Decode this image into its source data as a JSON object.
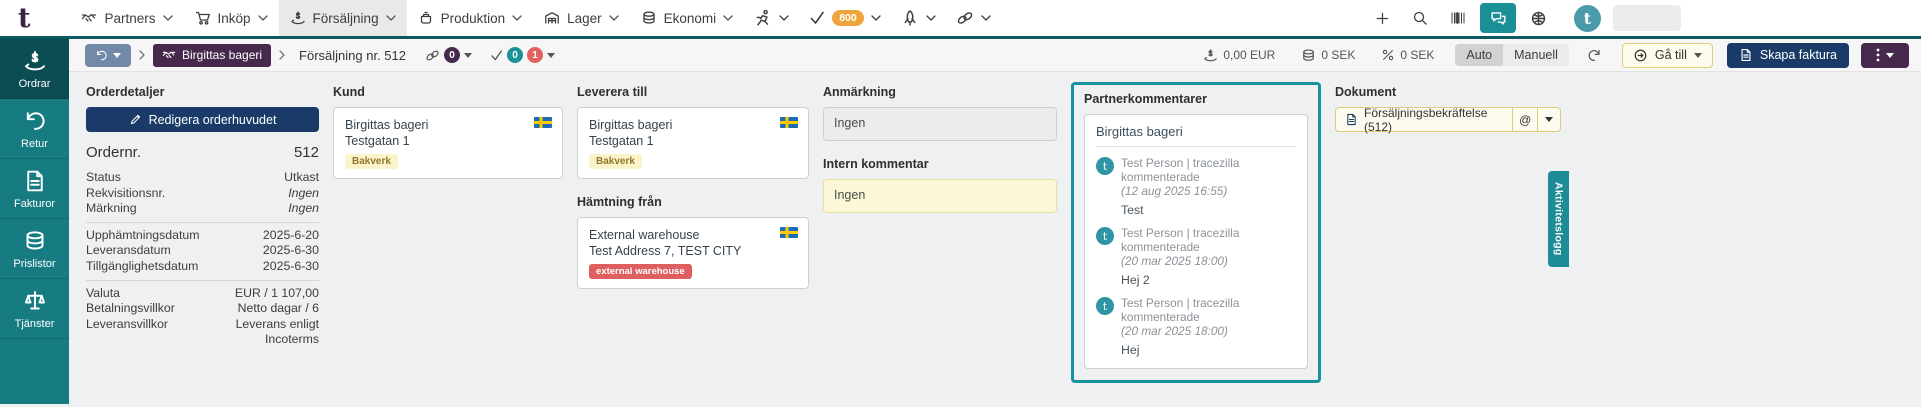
{
  "brand": {
    "letter": "t"
  },
  "topbar": {
    "nav": [
      {
        "label": "Partners"
      },
      {
        "label": "Inköp"
      },
      {
        "label": "Försäljning"
      },
      {
        "label": "Produktion"
      },
      {
        "label": "Lager"
      },
      {
        "label": "Ekonomi"
      }
    ],
    "tasks_badge": "800"
  },
  "toolbar": {
    "partner_chip": "Birgittas bageri",
    "order_label": "Försäljning nr. 512",
    "link_badge": "0",
    "check_badge_ok": "0",
    "check_badge_error": "1",
    "amount_eur": "0,00 EUR",
    "amount_sek": "0 SEK",
    "amount_margin": "0 SEK",
    "toggle_auto": "Auto",
    "toggle_manual": "Manuell",
    "go_to": "Gå till",
    "create_invoice": "Skapa faktura"
  },
  "sidebar": [
    {
      "label": "Ordrar"
    },
    {
      "label": "Retur"
    },
    {
      "label": "Fakturor"
    },
    {
      "label": "Prislistor"
    },
    {
      "label": "Tjänster"
    }
  ],
  "order_details": {
    "title": "Orderdetaljer",
    "edit_button": "Redigera orderhuvudet",
    "order_no_label": "Ordernr.",
    "order_no": "512",
    "rows": [
      {
        "label": "Status",
        "value": "Utkast"
      },
      {
        "label": "Rekvisitionsnr.",
        "value": "Ingen"
      },
      {
        "label": "Märkning",
        "value": "Ingen"
      },
      {
        "label": "Upphämtningsdatum",
        "value": "2025-6-20"
      },
      {
        "label": "Leveransdatum",
        "value": "2025-6-30"
      },
      {
        "label": "Tillgänglighetsdatum",
        "value": "2025-6-30"
      },
      {
        "label": "Valuta",
        "value": "EUR / 1 107,00"
      },
      {
        "label": "Betalningsvillkor",
        "value": "Netto dagar / 6"
      },
      {
        "label": "Leveransvillkor",
        "value": "Leverans enligt Incoterms"
      }
    ]
  },
  "customer": {
    "title": "Kund",
    "name": "Birgittas bageri",
    "address": "Testgatan 1",
    "tag": "Bakverk"
  },
  "deliver_to": {
    "title": "Leverera till",
    "name": "Birgittas bageri",
    "address": "Testgatan 1",
    "tag": "Bakverk"
  },
  "pickup_from": {
    "title": "Hämtning från",
    "name": "External warehouse",
    "address": "Test Address 7, TEST CITY",
    "tag": "external warehouse"
  },
  "remark": {
    "title": "Anmärkning",
    "value": "Ingen"
  },
  "internal_comment": {
    "title": "Intern kommentar",
    "value": "Ingen"
  },
  "partner_comments": {
    "title": "Partnerkommentarer",
    "partner": "Birgittas bageri",
    "comments": [
      {
        "author": "Test Person | tracezilla kommenterade",
        "date": "(12 aug 2025 16:55)",
        "text": "Test"
      },
      {
        "author": "Test Person | tracezilla kommenterade",
        "date": "(20 mar 2025 18:00)",
        "text": "Hej 2"
      },
      {
        "author": "Test Person | tracezilla kommenterade",
        "date": "(20 mar 2025 18:00)",
        "text": "Hej"
      }
    ]
  },
  "documents": {
    "title": "Dokument",
    "button": "Försäljningsbekräftelse (512)",
    "at": "@"
  },
  "activity_log": "Aktivitetslogg",
  "colors": {
    "teal": "#177b82",
    "teal_bright": "#1e8c96",
    "navy": "#1a3a68",
    "purple": "#46294d",
    "badge_orange": "#f0a43c",
    "badge_red": "#e2605e",
    "tag_red": "#dd5f5f"
  }
}
